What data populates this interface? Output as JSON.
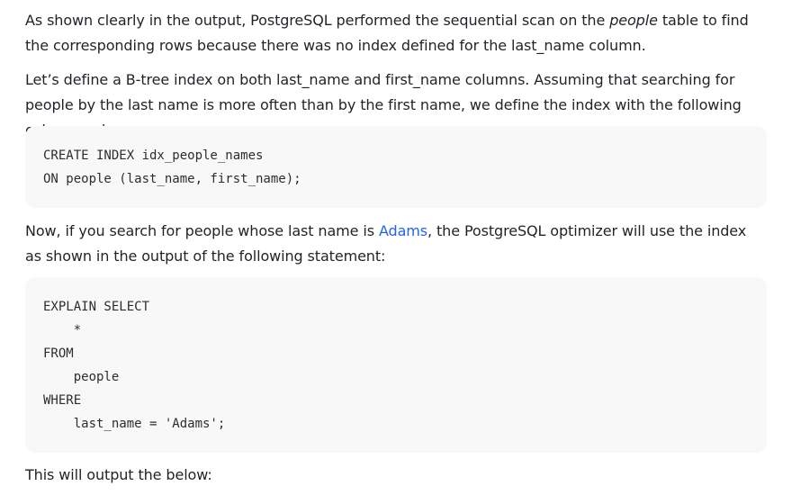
{
  "paragraph1": {
    "part1": "As shown clearly in the output, PostgreSQL performed the sequential scan on the ",
    "italic": "people",
    "part2": " table to find the corresponding rows because there was no index defined for the last_name column."
  },
  "paragraph2": {
    "text": "Let’s define a B-tree index on both last_name and first_name columns. Assuming that searching for people by the last name is more often than by the first name, we define the index with the following column order:"
  },
  "code_block_1": {
    "lines": [
      "CREATE INDEX idx_people_names",
      "ON people (last_name, first_name);"
    ]
  },
  "paragraph3": {
    "part1": "Now, if you search for people whose last name is ",
    "link": "Adams",
    "part2": ", the PostgreSQL optimizer will use the index as shown in the output of the following statement:"
  },
  "code_block_2": {
    "lines": [
      "EXPLAIN SELECT",
      "    *",
      "FROM",
      "    people",
      "WHERE",
      "    last_name = 'Adams';"
    ]
  },
  "paragraph4": {
    "text": "This will output the below:"
  },
  "colors": {
    "text": "#1f2328",
    "link": "#2563eb",
    "code_background": "#f8f8f8"
  }
}
